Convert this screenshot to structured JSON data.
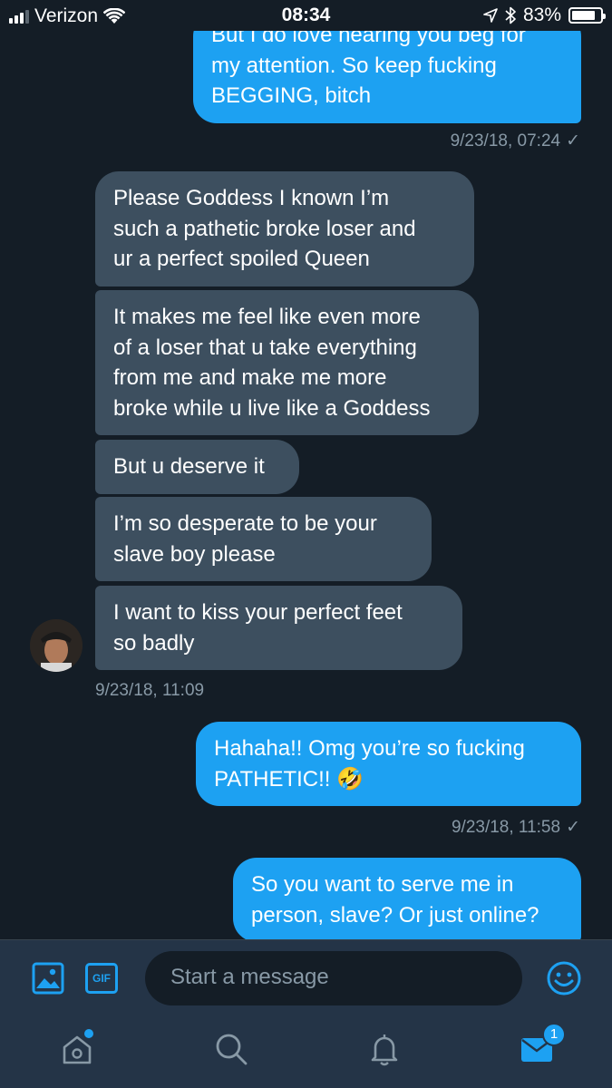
{
  "status_bar": {
    "carrier": "Verizon",
    "time": "08:34",
    "battery": "83%",
    "battery_level": 0.83
  },
  "messages": {
    "sent_1": "But I do love hearing you beg for\nmy attention. So keep fucking\nBEGGING, bitch",
    "sent_1_time": "9/23/18, 07:24",
    "received_1": "Please Goddess I known I’m\nsuch a pathetic broke loser and\nur a perfect spoiled Queen",
    "received_2": "It makes me feel like even more\nof a loser that u take everything\nfrom me and make me more\nbroke while u live like a Goddess",
    "received_3": "But u deserve it",
    "received_4": "I’m so desperate to be your\nslave boy please",
    "received_5": "I want to kiss your perfect feet\nso badly",
    "received_time": "9/23/18, 11:09",
    "sent_2": "Hahaha!! Omg you’re so fucking\nPATHETIC!! 🤣",
    "sent_2_time": "9/23/18, 11:58",
    "sent_3": "So you want to serve me in\nperson, slave? Or just online?",
    "read_check": "✓"
  },
  "composer": {
    "placeholder": "Start a message",
    "gif_label": "GIF"
  },
  "tabbar": {
    "messages_badge": "1"
  },
  "colors": {
    "background": "#141d26",
    "outgoing": "#1da1f2",
    "incoming": "#3d4f5f",
    "bar": "#243447",
    "muted": "#8899a6"
  }
}
